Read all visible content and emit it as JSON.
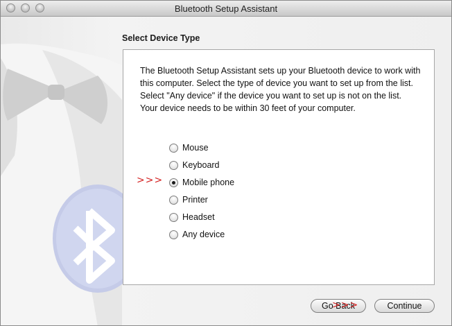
{
  "window": {
    "title": "Bluetooth Setup Assistant"
  },
  "page": {
    "heading": "Select Device Type",
    "description": "The Bluetooth Setup Assistant sets up your Bluetooth device to work with this computer. Select the type of device you want to set up from the list. Select \"Any device\" if the device you want to set up is not on the list. Your device needs to be within 30 feet of your computer."
  },
  "device_types": [
    {
      "label": "Mouse",
      "selected": false
    },
    {
      "label": "Keyboard",
      "selected": false
    },
    {
      "label": "Mobile phone",
      "selected": true
    },
    {
      "label": "Printer",
      "selected": false
    },
    {
      "label": "Headset",
      "selected": false
    },
    {
      "label": "Any device",
      "selected": false
    }
  ],
  "annotations": {
    "selection_arrows": ">>>",
    "button_arrows": ">>>"
  },
  "buttons": {
    "go_back": "Go Back",
    "continue": "Continue"
  }
}
